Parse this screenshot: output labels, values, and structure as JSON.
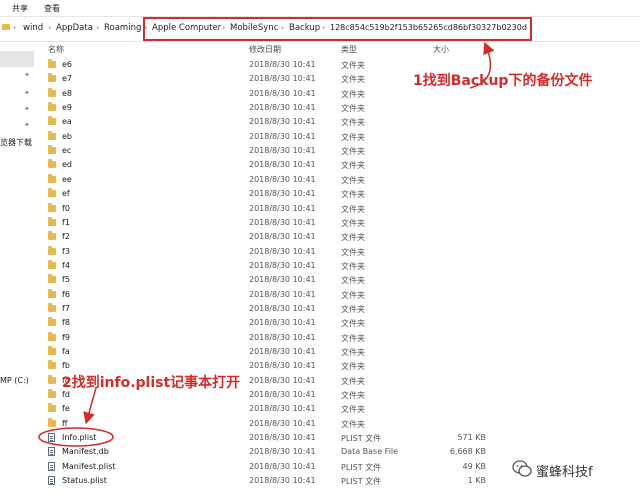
{
  "ribbon": {
    "share": "共享",
    "view": "查看"
  },
  "address": {
    "left_segments": [
      "wind",
      "AppData",
      "Roaming"
    ],
    "boxed_segments": [
      "Apple Computer",
      "MobileSync",
      "Backup",
      "128c854c519b2f153b65265cd86bf30327b0230d"
    ]
  },
  "nav": {
    "downloads_label": "览器下载",
    "drive_label": "MP (C:)"
  },
  "columns": {
    "name": "名称",
    "date": "修改日期",
    "type": "类型",
    "size": "大小"
  },
  "rows": [
    {
      "name": "e6",
      "date": "2018/8/30 10:41",
      "type": "文件夹",
      "size": "",
      "kind": "folder"
    },
    {
      "name": "e7",
      "date": "2018/8/30 10:41",
      "type": "文件夹",
      "size": "",
      "kind": "folder"
    },
    {
      "name": "e8",
      "date": "2018/8/30 10:41",
      "type": "文件夹",
      "size": "",
      "kind": "folder"
    },
    {
      "name": "e9",
      "date": "2018/8/30 10:41",
      "type": "文件夹",
      "size": "",
      "kind": "folder"
    },
    {
      "name": "ea",
      "date": "2018/8/30 10:41",
      "type": "文件夹",
      "size": "",
      "kind": "folder"
    },
    {
      "name": "eb",
      "date": "2018/8/30 10:41",
      "type": "文件夹",
      "size": "",
      "kind": "folder"
    },
    {
      "name": "ec",
      "date": "2018/8/30 10:41",
      "type": "文件夹",
      "size": "",
      "kind": "folder"
    },
    {
      "name": "ed",
      "date": "2018/8/30 10:41",
      "type": "文件夹",
      "size": "",
      "kind": "folder"
    },
    {
      "name": "ee",
      "date": "2018/8/30 10:41",
      "type": "文件夹",
      "size": "",
      "kind": "folder"
    },
    {
      "name": "ef",
      "date": "2018/8/30 10:41",
      "type": "文件夹",
      "size": "",
      "kind": "folder"
    },
    {
      "name": "f0",
      "date": "2018/8/30 10:41",
      "type": "文件夹",
      "size": "",
      "kind": "folder"
    },
    {
      "name": "f1",
      "date": "2018/8/30 10:41",
      "type": "文件夹",
      "size": "",
      "kind": "folder"
    },
    {
      "name": "f2",
      "date": "2018/8/30 10:41",
      "type": "文件夹",
      "size": "",
      "kind": "folder"
    },
    {
      "name": "f3",
      "date": "2018/8/30 10:41",
      "type": "文件夹",
      "size": "",
      "kind": "folder"
    },
    {
      "name": "f4",
      "date": "2018/8/30 10:41",
      "type": "文件夹",
      "size": "",
      "kind": "folder"
    },
    {
      "name": "f5",
      "date": "2018/8/30 10:41",
      "type": "文件夹",
      "size": "",
      "kind": "folder"
    },
    {
      "name": "f6",
      "date": "2018/8/30 10:41",
      "type": "文件夹",
      "size": "",
      "kind": "folder"
    },
    {
      "name": "f7",
      "date": "2018/8/30 10:41",
      "type": "文件夹",
      "size": "",
      "kind": "folder"
    },
    {
      "name": "f8",
      "date": "2018/8/30 10:41",
      "type": "文件夹",
      "size": "",
      "kind": "folder"
    },
    {
      "name": "f9",
      "date": "2018/8/30 10:41",
      "type": "文件夹",
      "size": "",
      "kind": "folder"
    },
    {
      "name": "fa",
      "date": "2018/8/30 10:41",
      "type": "文件夹",
      "size": "",
      "kind": "folder"
    },
    {
      "name": "fb",
      "date": "2018/8/30 10:41",
      "type": "文件夹",
      "size": "",
      "kind": "folder"
    },
    {
      "name": "fc",
      "date": "2018/8/30 10:41",
      "type": "文件夹",
      "size": "",
      "kind": "folder"
    },
    {
      "name": "fd",
      "date": "2018/8/30 10:41",
      "type": "文件夹",
      "size": "",
      "kind": "folder"
    },
    {
      "name": "fe",
      "date": "2018/8/30 10:41",
      "type": "文件夹",
      "size": "",
      "kind": "folder"
    },
    {
      "name": "ff",
      "date": "2018/8/30 10:41",
      "type": "文件夹",
      "size": "",
      "kind": "folder"
    },
    {
      "name": "Info.plist",
      "date": "2018/8/30 10:41",
      "type": "PLIST 文件",
      "size": "571 KB",
      "kind": "file"
    },
    {
      "name": "Manifest.db",
      "date": "2018/8/30 10:41",
      "type": "Data Base File",
      "size": "6,668 KB",
      "kind": "file"
    },
    {
      "name": "Manifest.plist",
      "date": "2018/8/30 10:41",
      "type": "PLIST 文件",
      "size": "49 KB",
      "kind": "file"
    },
    {
      "name": "Status.plist",
      "date": "2018/8/30 10:41",
      "type": "PLIST 文件",
      "size": "1 KB",
      "kind": "file"
    }
  ],
  "annotations": {
    "step1": "1找到Backup下的备份文件",
    "step2": "2找到info.plist记事本打开"
  },
  "watermark": {
    "text": "蜜蜂科技f"
  },
  "colors": {
    "annotation_red": "#d42b2b",
    "folder_yellow": "#e8b84a"
  }
}
